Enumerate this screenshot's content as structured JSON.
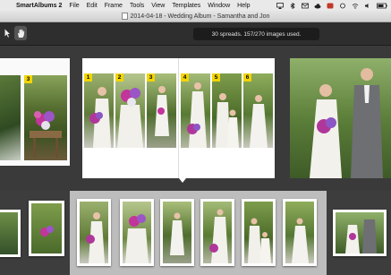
{
  "menubar": {
    "app_name": "SmartAlbums 2",
    "items": [
      "File",
      "Edit",
      "Frame",
      "Tools",
      "View",
      "Templates",
      "Window",
      "Help"
    ]
  },
  "window": {
    "title": "2014-04-18 - Wedding Album - Samantha and Jon"
  },
  "toolbar": {
    "status": "30 spreads. 157/270 images used.",
    "tools": [
      "arrow-tool",
      "hand-tool"
    ]
  },
  "spreads": {
    "left_slot_number": "3",
    "center_slot_numbers": [
      "1",
      "2",
      "3",
      "4",
      "5",
      "6"
    ]
  },
  "colors": {
    "accent_badge": "#f2d500",
    "selection_strip": "#bdbdbd"
  }
}
